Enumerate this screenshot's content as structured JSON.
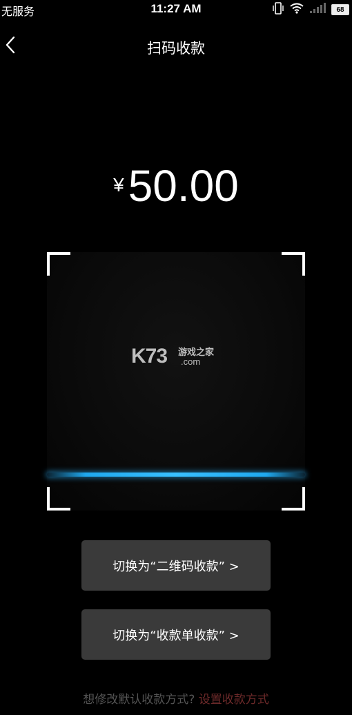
{
  "status_bar": {
    "carrier": "无服务",
    "time": "11:27 AM",
    "battery": "68",
    "icons": [
      "vibrate-icon",
      "wifi-icon",
      "signal-icon",
      "battery-icon"
    ]
  },
  "nav": {
    "back_icon": "chevron-left-icon",
    "title": "扫码收款"
  },
  "amount": {
    "currency": "¥",
    "value": "50.00"
  },
  "scanner": {
    "watermark_logo": "K73",
    "watermark_sub": "游戏之家",
    "watermark_domain": ".com",
    "scan_line_color": "#1fa8ee"
  },
  "buttons": {
    "switch_qr": "切换为“二维码收款” >",
    "switch_bill": "切换为“收款单收款” >"
  },
  "footer": {
    "hint": "想修改默认收款方式?",
    "link": "设置收款方式",
    "link_color": "#6e2a2a"
  }
}
